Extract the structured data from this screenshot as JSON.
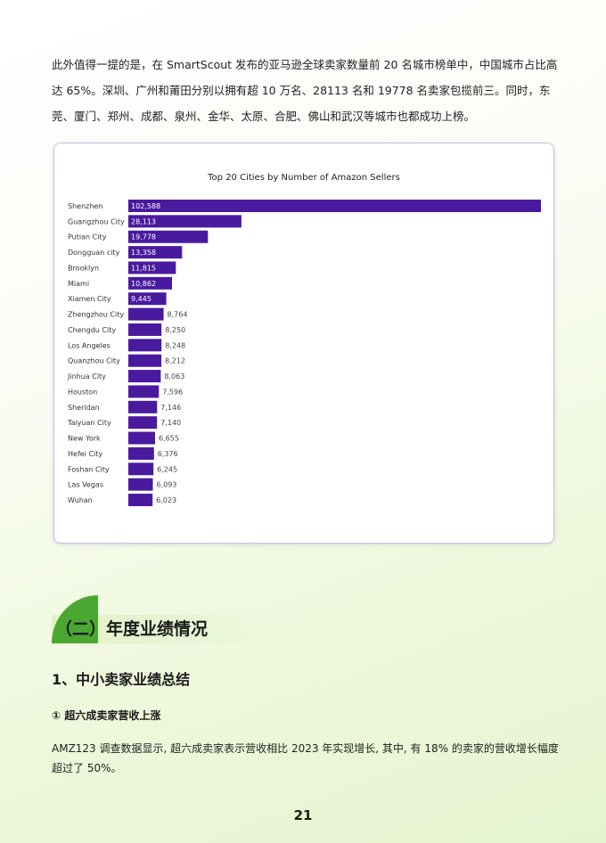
{
  "intro_paragraph": "此外值得一提的是，在 SmartScout 发布的亚马逊全球卖家数量前 20 名城市榜单中，中国城市占比高达 65%。深圳、广州和莆田分别以拥有超 10 万名、28113 名和 19778 名卖家包揽前三。同时，东莞、厦门、郑州、成都、泉州、金华、太原、合肥、佛山和武汉等城市也都成功上榜。",
  "chart_data": {
    "type": "bar",
    "orientation": "horizontal",
    "title": "Top 20 Cities by Number of Amazon Sellers",
    "xlabel": "",
    "ylabel": "",
    "grid": false,
    "legend": "none",
    "bar_color": "#4a1a9e",
    "categories": [
      "Shenzhen",
      "Guangzhou City",
      "Putian City",
      "Dongguan city",
      "Brooklyn",
      "Miami",
      "Xiamen City",
      "Zhengzhou City",
      "Chengdu City",
      "Los Angeles",
      "Quanzhou City",
      "Jinhua City",
      "Houston",
      "Sheridan",
      "Taiyuan City",
      "New York",
      "Hefei City",
      "Foshan City",
      "Las Vegas",
      "Wuhan"
    ],
    "values": [
      102588,
      28113,
      19778,
      13358,
      11815,
      10862,
      9445,
      8764,
      8250,
      8248,
      8212,
      8063,
      7596,
      7146,
      7140,
      6655,
      6376,
      6245,
      6093,
      6023
    ],
    "value_labels": [
      "102,588",
      "28,113",
      "19,778",
      "13,358",
      "11,815",
      "10,862",
      "9,445",
      "8,764",
      "8,250",
      "8,248",
      "8,212",
      "8,063",
      "7,596",
      "7,146",
      "7,140",
      "6,655",
      "6,376",
      "6,245",
      "6,093",
      "6,023"
    ]
  },
  "section": {
    "title": "（二）年度业绩情况"
  },
  "sub_heading": "1、中小卖家业绩总结",
  "point_heading": "① 超六成卖家营收上涨",
  "body_paragraph": "AMZ123 调查数据显示, 超六成卖家表示营收相比 2023 年实现增长, 其中, 有 18% 的卖家的营收增长幅度超过了 50%。",
  "page_number": "21"
}
